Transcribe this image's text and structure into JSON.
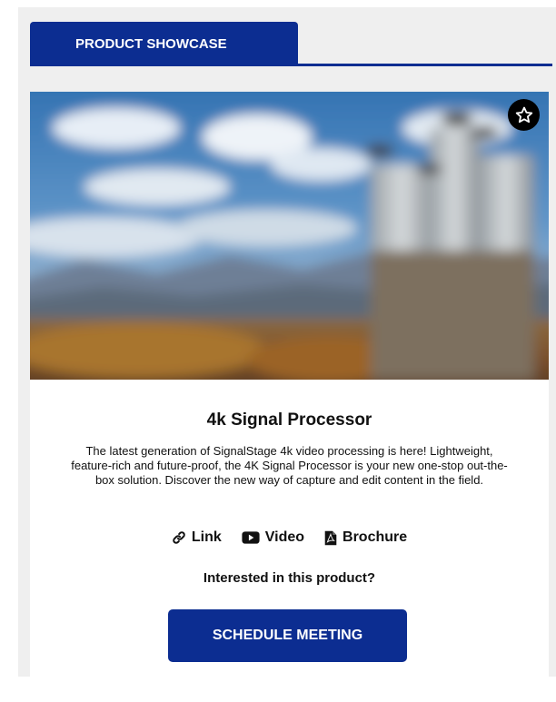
{
  "tabs": {
    "active_label": "PRODUCT SHOWCASE"
  },
  "product": {
    "title": "4k Signal Processor",
    "description": "The latest generation of SignalStage 4k video processing is here! Lightweight, feature-rich and future-proof, the 4K Signal Processor is your new one-stop out-the-box solution. Discover the new way of capture and edit content in the field.",
    "favorite_icon": "star-outline-icon",
    "resources": [
      {
        "label": "Link",
        "icon": "link-icon"
      },
      {
        "label": "Video",
        "icon": "video-icon"
      },
      {
        "label": "Brochure",
        "icon": "pdf-icon"
      }
    ],
    "interest_prompt": "Interested in this product?",
    "cta_label": "SCHEDULE MEETING"
  },
  "colors": {
    "brand": "#0c2d91",
    "panel_bg": "#efefef",
    "card_bg": "#ffffff"
  }
}
